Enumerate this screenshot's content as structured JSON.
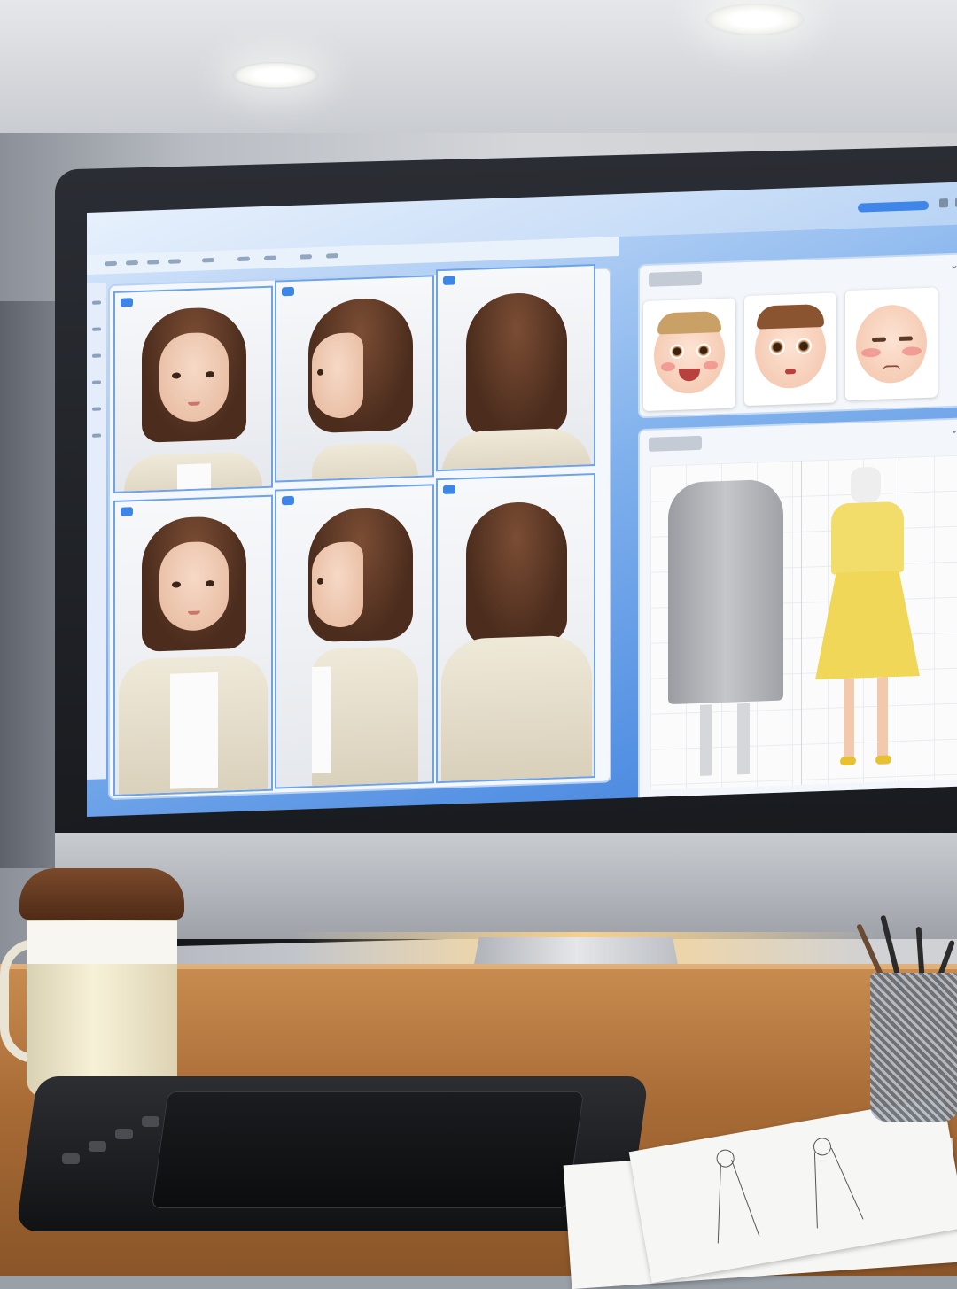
{
  "scene": {
    "description_tags": [
      "desk",
      "monitor",
      "coffee-cup",
      "drawing-tablet",
      "sketches",
      "pencil-cup"
    ]
  },
  "screen": {
    "turnaround_views": [
      "front",
      "side",
      "back",
      "front",
      "side",
      "back"
    ],
    "expressions_panel": {
      "title": ""
    },
    "outfits_panel": {
      "title": ""
    },
    "expressions": [
      "happy",
      "surprised",
      "sad"
    ],
    "outfits": [
      "grey-trench-coat",
      "yellow-dress"
    ]
  },
  "colors": {
    "screen_blue": "#3d7fde",
    "hair_brown": "#5a3422",
    "sweater_cream": "#e8e1cf",
    "coat_grey": "#a9abb0",
    "dress_yellow": "#f3dd6a",
    "desk_wood": "#a86b36"
  }
}
